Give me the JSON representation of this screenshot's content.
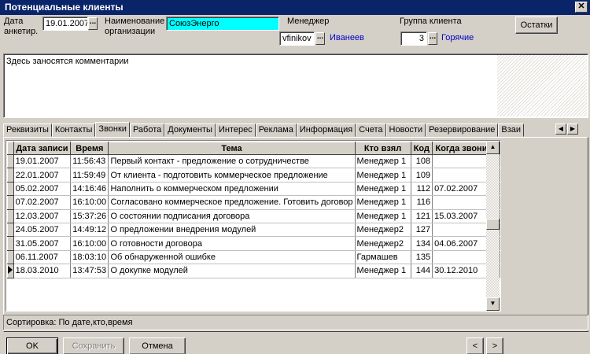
{
  "window": {
    "title": "Потенциальные клиенты",
    "close_glyph": "✕"
  },
  "header": {
    "date_label_1": "Дата",
    "date_label_2": "анкетир.",
    "date_value": "19.01.2007",
    "name_label_1": "Наименование",
    "name_label_2": "организации",
    "name_value": "СоюзЭнерго",
    "name_bg_color": "#00ffff",
    "manager_label": "Менеджер",
    "manager_login": "vfinikov",
    "manager_name": "Иванеев",
    "group_label": "Группа клиента",
    "group_value": "3",
    "group_name": "Горячие",
    "dots": "...",
    "remains_button": "Остатки"
  },
  "comment": {
    "text": "Здесь заносятся комментарии"
  },
  "tabs": [
    {
      "label": "Реквизиты"
    },
    {
      "label": "Контакты"
    },
    {
      "label": "Звонки",
      "active": true
    },
    {
      "label": "Работа"
    },
    {
      "label": "Документы"
    },
    {
      "label": "Интерес"
    },
    {
      "label": "Реклама"
    },
    {
      "label": "Информация"
    },
    {
      "label": "Счета"
    },
    {
      "label": "Новости"
    },
    {
      "label": "Резервирование"
    },
    {
      "label": "Взаи"
    }
  ],
  "tab_nav": {
    "prev": "◀",
    "next": "▶"
  },
  "calls_table": {
    "columns": [
      "Дата записи",
      "Время",
      "Тема",
      "Кто взял",
      "Код",
      "Когда звонить"
    ],
    "rows": [
      [
        "19.01.2007",
        "11:56:43",
        "Первый контакт - предложение о сотрудничестве",
        "Менеджер 1",
        "108",
        ""
      ],
      [
        "22.01.2007",
        "11:59:49",
        "От клиента - подготовить коммерческое предложение",
        "Менеджер 1",
        "109",
        ""
      ],
      [
        "05.02.2007",
        "14:16:46",
        "Наполнить о коммерческом предложении",
        "Менеджер 1",
        "112",
        "07.02.2007"
      ],
      [
        "07.02.2007",
        "16:10:00",
        "Согласовано коммерческое предложение. Готовить договор",
        "Менеджер 1",
        "116",
        ""
      ],
      [
        "12.03.2007",
        "15:37:26",
        "О состоянии подписания договора",
        "Менеджер 1",
        "121",
        "15.03.2007"
      ],
      [
        "24.05.2007",
        "14:49:12",
        "О предложении внедрения модулей",
        "Менеджер2",
        "127",
        ""
      ],
      [
        "31.05.2007",
        "16:10:00",
        "О готовности договора",
        "Менеджер2",
        "134",
        "04.06.2007"
      ],
      [
        "06.11.2007",
        "18:03:10",
        "Об обнаруженной ошибке",
        "Гармашев",
        "135",
        ""
      ],
      [
        "18.03.2010",
        "13:47:53",
        "О докупке модулей",
        "Менеджер 1",
        "144",
        "30.12.2010"
      ]
    ],
    "current_row_index": 8
  },
  "scrollbar": {
    "up": "▲",
    "down": "▼"
  },
  "status": {
    "text": "Сортировка: По дате,кто,время"
  },
  "footer": {
    "ok": "OK",
    "save": "Сохранить",
    "cancel": "Отмена",
    "prev": "<",
    "next": ">"
  }
}
